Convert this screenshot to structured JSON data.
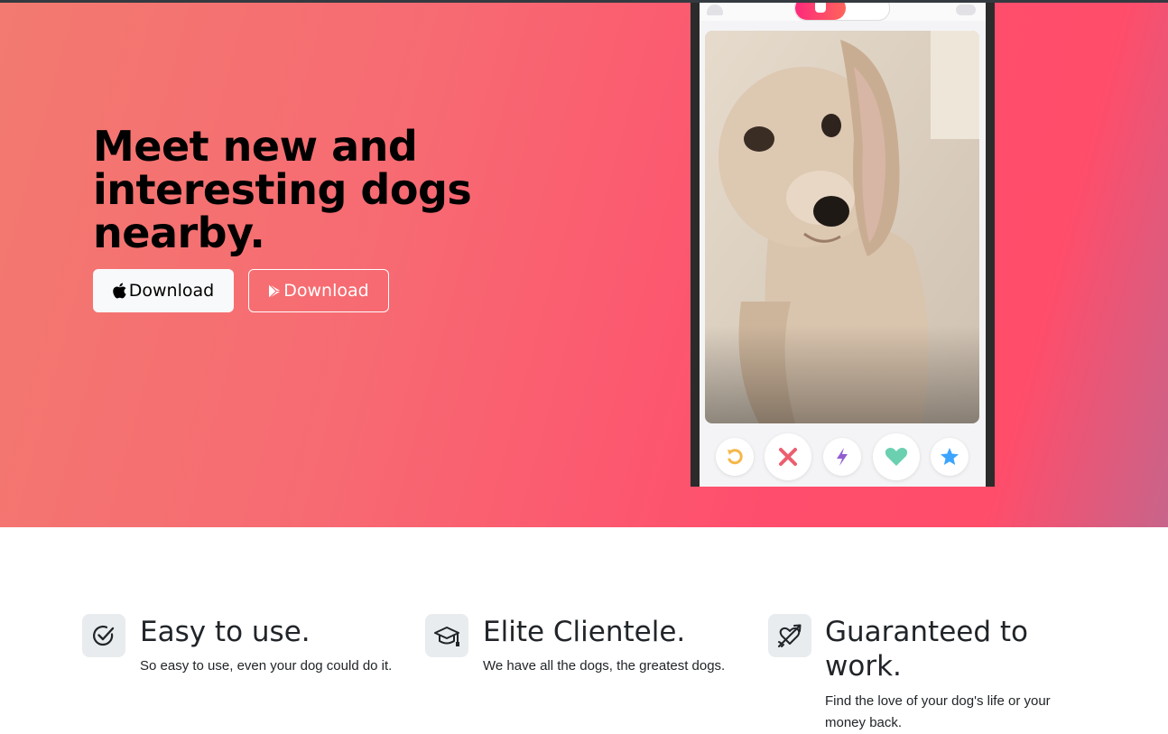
{
  "hero": {
    "title": "Meet new and interesting dogs nearby.",
    "buttons": [
      {
        "label": "Download",
        "icon": "apple-icon"
      },
      {
        "label": "Download",
        "icon": "google-play-icon"
      }
    ],
    "colors": {
      "gradient_start": "#f27a70",
      "gradient_mid": "#ff4d6d",
      "gradient_end": "#c8648a"
    }
  },
  "phone": {
    "photo": "dog-photo",
    "actions": [
      "rewind-icon",
      "nope-icon",
      "boost-icon",
      "like-icon",
      "super-like-icon"
    ],
    "action_colors": {
      "rewind": "#f5b748",
      "nope": "#ec5e6f",
      "boost": "#915dd1",
      "like": "#6bd0b0",
      "super_like": "#3ca4ff"
    }
  },
  "features": [
    {
      "icon": "check-circle-icon",
      "title": "Easy to use.",
      "text": "So easy to use, even your dog could do it."
    },
    {
      "icon": "graduation-cap-icon",
      "title": "Elite Clientele.",
      "text": "We have all the dogs, the greatest dogs."
    },
    {
      "icon": "heart-arrow-icon",
      "title": "Guaranteed to work.",
      "text": "Find the love of your dog's life or your money back."
    }
  ]
}
